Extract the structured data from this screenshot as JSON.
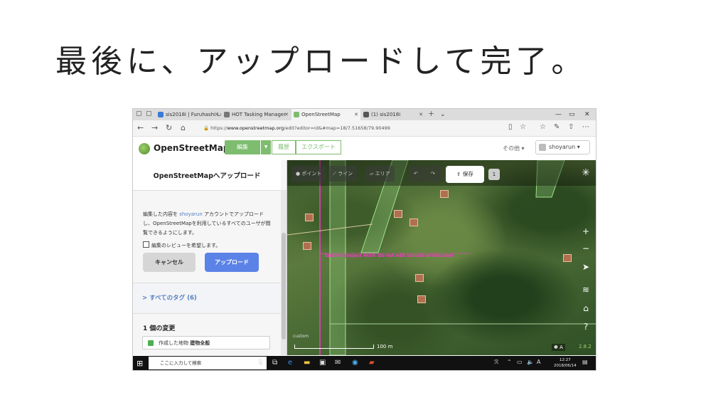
{
  "slide_title": "最後に、アップロードして完了。",
  "browser": {
    "tabs": [
      {
        "label": "sis2018i | Furuhashi Lab Sla",
        "fav_color": "#3a7bd5"
      },
      {
        "label": "HOT Tasking Manager",
        "fav_color": "#777777"
      },
      {
        "label": "OpenStreetMap",
        "fav_color": "#7ebc6f"
      },
      {
        "label": "(1) sis2018i",
        "fav_color": "#555555"
      }
    ],
    "url_prefix": "https://",
    "url_host": "www.openstreetmap.org",
    "url_rest": "/edit?editor=id&#map=18/7.51658/79.90499"
  },
  "osm": {
    "name": "OpenStreetMap",
    "edit_label": "編集",
    "history_label": "履歴",
    "export_label": "エクスポート",
    "more_label": "その他 ▾",
    "user": "shoyarun"
  },
  "sidebar": {
    "title": "OpenStreetMapへアップロード",
    "msg_1": "編集した内容を ",
    "msg_user": "shoyarun",
    "msg_2": " アカウントでアップロードし、OpenStreetMapを利用しているすべてのユーザが閲覧できるようにします。",
    "review_label": "編集のレビューを希望します。",
    "cancel_label": "キャンセル",
    "upload_label": "アップロード",
    "tags_label": "> すべてのタグ (6)",
    "changes_title": "1 個の変更",
    "change_item_type": "作成した地物",
    "change_item_name": "建物全般"
  },
  "map": {
    "tools": [
      "ポイント",
      "ライン",
      "エリア"
    ],
    "save_label": "保存",
    "save_count": "1",
    "task_label": "Task for project 4639. Do not edit outside of this box!",
    "custom_label": "custom",
    "scale_label": "100 m",
    "version": "2.8.2"
  },
  "taskbar": {
    "search_placeholder": "ここに入力して検索",
    "time": "12:27",
    "date": "2018/06/14",
    "ime": "A"
  }
}
